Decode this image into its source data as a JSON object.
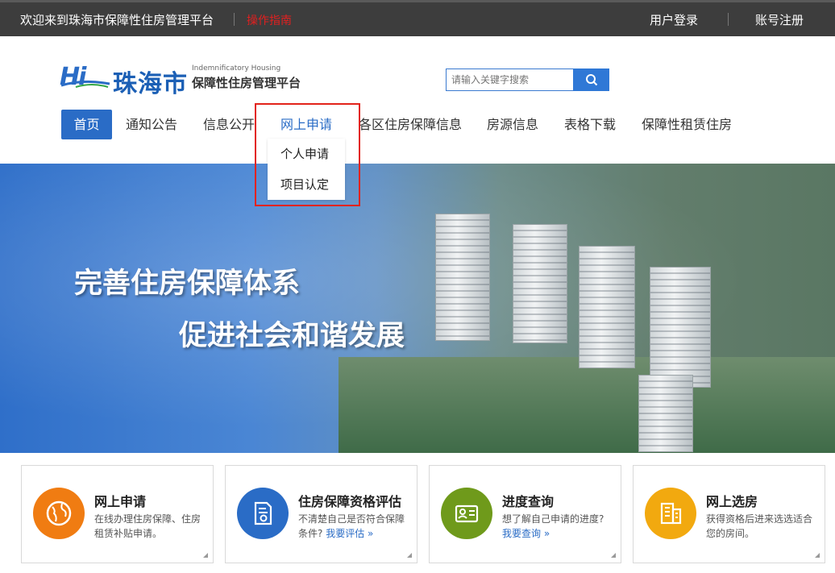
{
  "topbar": {
    "welcome": "欢迎来到珠海市保障性住房管理平台",
    "guide": "操作指南",
    "login": "用户登录",
    "register": "账号注册"
  },
  "logo": {
    "hi": "Hi",
    "city": "珠海市",
    "en": "Indemnificatory Housing",
    "cn": "保障性住房管理平台"
  },
  "search": {
    "placeholder": "请输入关键字搜索"
  },
  "nav": {
    "items": [
      "首页",
      "通知公告",
      "信息公开",
      "网上申请",
      "各区住房保障信息",
      "房源信息",
      "表格下载",
      "保障性租赁住房"
    ]
  },
  "dropdown": {
    "items": [
      "个人申请",
      "项目认定"
    ]
  },
  "banner": {
    "slogan1": "完善住房保障体系",
    "slogan2": "促进社会和谐发展"
  },
  "cards": [
    {
      "title": "网上申请",
      "desc": "在线办理住房保障、住房租赁补贴申请。",
      "link": "",
      "icon": "globe-icon",
      "color": "#f07c12"
    },
    {
      "title": "住房保障资格评估",
      "desc": "不清楚自己是否符合保障条件?",
      "link": "我要评估 »",
      "icon": "certificate-icon",
      "color": "#2a6cc6"
    },
    {
      "title": "进度查询",
      "desc": "想了解自己申请的进度?",
      "link": "我要查询 »",
      "icon": "id-card-icon",
      "color": "#6f9a1b"
    },
    {
      "title": "网上选房",
      "desc": "获得资格后进来选选适合您的房间。",
      "link": "",
      "icon": "building-icon",
      "color": "#f2a90f"
    }
  ],
  "colors": {
    "topbar_bg": "#3d3d3d",
    "accent": "#2a6cc6",
    "highlight_box": "#e2231a"
  }
}
